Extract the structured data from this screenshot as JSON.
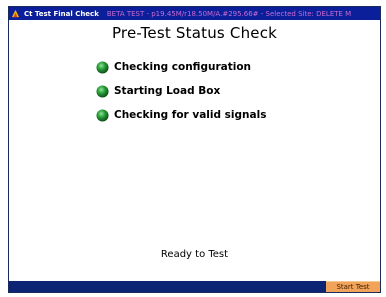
{
  "window": {
    "title": "Ct Test Final Check",
    "info": "BETA TEST - p19.45M/r18.50M/A.#295.66# - Selected Site: DELETE M",
    "app_icon": "app-logo-icon"
  },
  "main": {
    "title": "Pre-Test Status Check",
    "checks": [
      {
        "label": "Checking configuration",
        "status_icon": "green-status-icon"
      },
      {
        "label": "Starting Load Box",
        "status_icon": "green-status-icon"
      },
      {
        "label": "Checking for valid signals",
        "status_icon": "green-status-icon"
      }
    ],
    "status_message": "Ready to Test"
  },
  "footer": {
    "start_label": "Start Test"
  },
  "colors": {
    "titlebar": "#0b1f9a",
    "title_info": "#c96bd0",
    "status_ok": "#1f8a2a",
    "start_button": "#f2a35a",
    "footer_bar": "#0b2474"
  }
}
